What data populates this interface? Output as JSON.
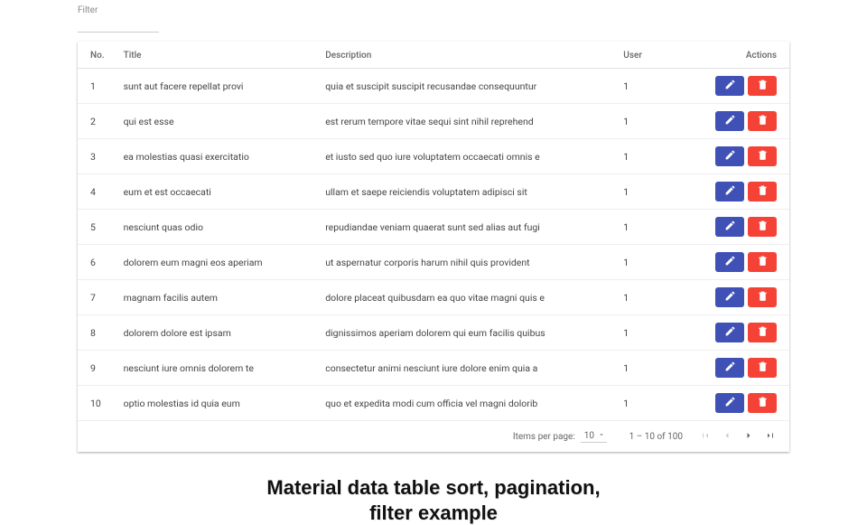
{
  "filter": {
    "label": "Filter",
    "value": ""
  },
  "columns": {
    "no": "No.",
    "title": "Title",
    "description": "Description",
    "user": "User",
    "actions": "Actions"
  },
  "rows": [
    {
      "no": "1",
      "title": "sunt aut facere repellat provi",
      "desc": "quia et suscipit suscipit recusandae consequuntur",
      "user": "1"
    },
    {
      "no": "2",
      "title": "qui est esse",
      "desc": "est rerum tempore vitae sequi sint nihil reprehend",
      "user": "1"
    },
    {
      "no": "3",
      "title": "ea molestias quasi exercitatio",
      "desc": "et iusto sed quo iure voluptatem occaecati omnis e",
      "user": "1"
    },
    {
      "no": "4",
      "title": "eum et est occaecati",
      "desc": "ullam et saepe reiciendis voluptatem adipisci sit",
      "user": "1"
    },
    {
      "no": "5",
      "title": "nesciunt quas odio",
      "desc": "repudiandae veniam quaerat sunt sed alias aut fugi",
      "user": "1"
    },
    {
      "no": "6",
      "title": "dolorem eum magni eos aperiam",
      "desc": "ut aspernatur corporis harum nihil quis provident",
      "user": "1"
    },
    {
      "no": "7",
      "title": "magnam facilis autem",
      "desc": "dolore placeat quibusdam ea quo vitae magni quis e",
      "user": "1"
    },
    {
      "no": "8",
      "title": "dolorem dolore est ipsam",
      "desc": "dignissimos aperiam dolorem qui eum facilis quibus",
      "user": "1"
    },
    {
      "no": "9",
      "title": "nesciunt iure omnis dolorem te",
      "desc": "consectetur animi nesciunt iure dolore enim quia a",
      "user": "1"
    },
    {
      "no": "10",
      "title": "optio molestias id quia eum",
      "desc": "quo et expedita modi cum officia vel magni dolorib",
      "user": "1"
    }
  ],
  "paginator": {
    "items_per_page_label": "Items per page:",
    "page_size_value": "10",
    "range_label": "1 – 10 of 100"
  },
  "caption": {
    "line1": "Material data table sort, pagination,",
    "line2": "filter example"
  }
}
